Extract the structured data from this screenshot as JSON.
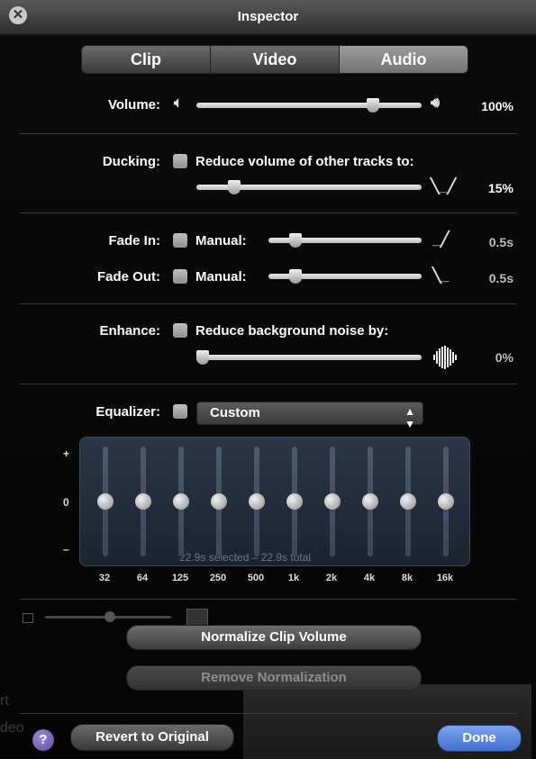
{
  "window": {
    "title": "Inspector",
    "close_icon": "close-icon"
  },
  "tabs": [
    {
      "label": "Clip"
    },
    {
      "label": "Video"
    },
    {
      "label": "Audio"
    }
  ],
  "active_tab": "Audio",
  "volume": {
    "label": "Volume:",
    "value_text": "100%",
    "level": 0.8
  },
  "ducking": {
    "label": "Ducking:",
    "option_label": "Reduce volume of other tracks to:",
    "value_text": "15%",
    "level": 0.15
  },
  "fade_in": {
    "label": "Fade In:",
    "option_label": "Manual:",
    "value_text": "0.5s",
    "level": 0.15
  },
  "fade_out": {
    "label": "Fade Out:",
    "option_label": "Manual:",
    "value_text": "0.5s",
    "level": 0.15
  },
  "enhance": {
    "label": "Enhance:",
    "option_label": "Reduce background noise by:",
    "value_text": "0%",
    "level": 0.0
  },
  "equalizer": {
    "label": "Equalizer:",
    "preset": "Custom",
    "axis": {
      "plus": "+",
      "zero": "0",
      "minus": "–"
    },
    "bands": [
      "32",
      "64",
      "125",
      "250",
      "500",
      "1k",
      "2k",
      "4k",
      "8k",
      "16k"
    ],
    "ghost_text": "22.9s selected – 22.9s total"
  },
  "buttons": {
    "normalize": "Normalize Clip Volume",
    "remove_normalization": "Remove Normalization",
    "revert": "Revert to Original",
    "done": "Done",
    "help": "?"
  },
  "background_text": {
    "a": "rt",
    "b": "deo"
  },
  "colors": {
    "done_button": "#3f6fd0",
    "equalizer_bg": "#243040"
  }
}
